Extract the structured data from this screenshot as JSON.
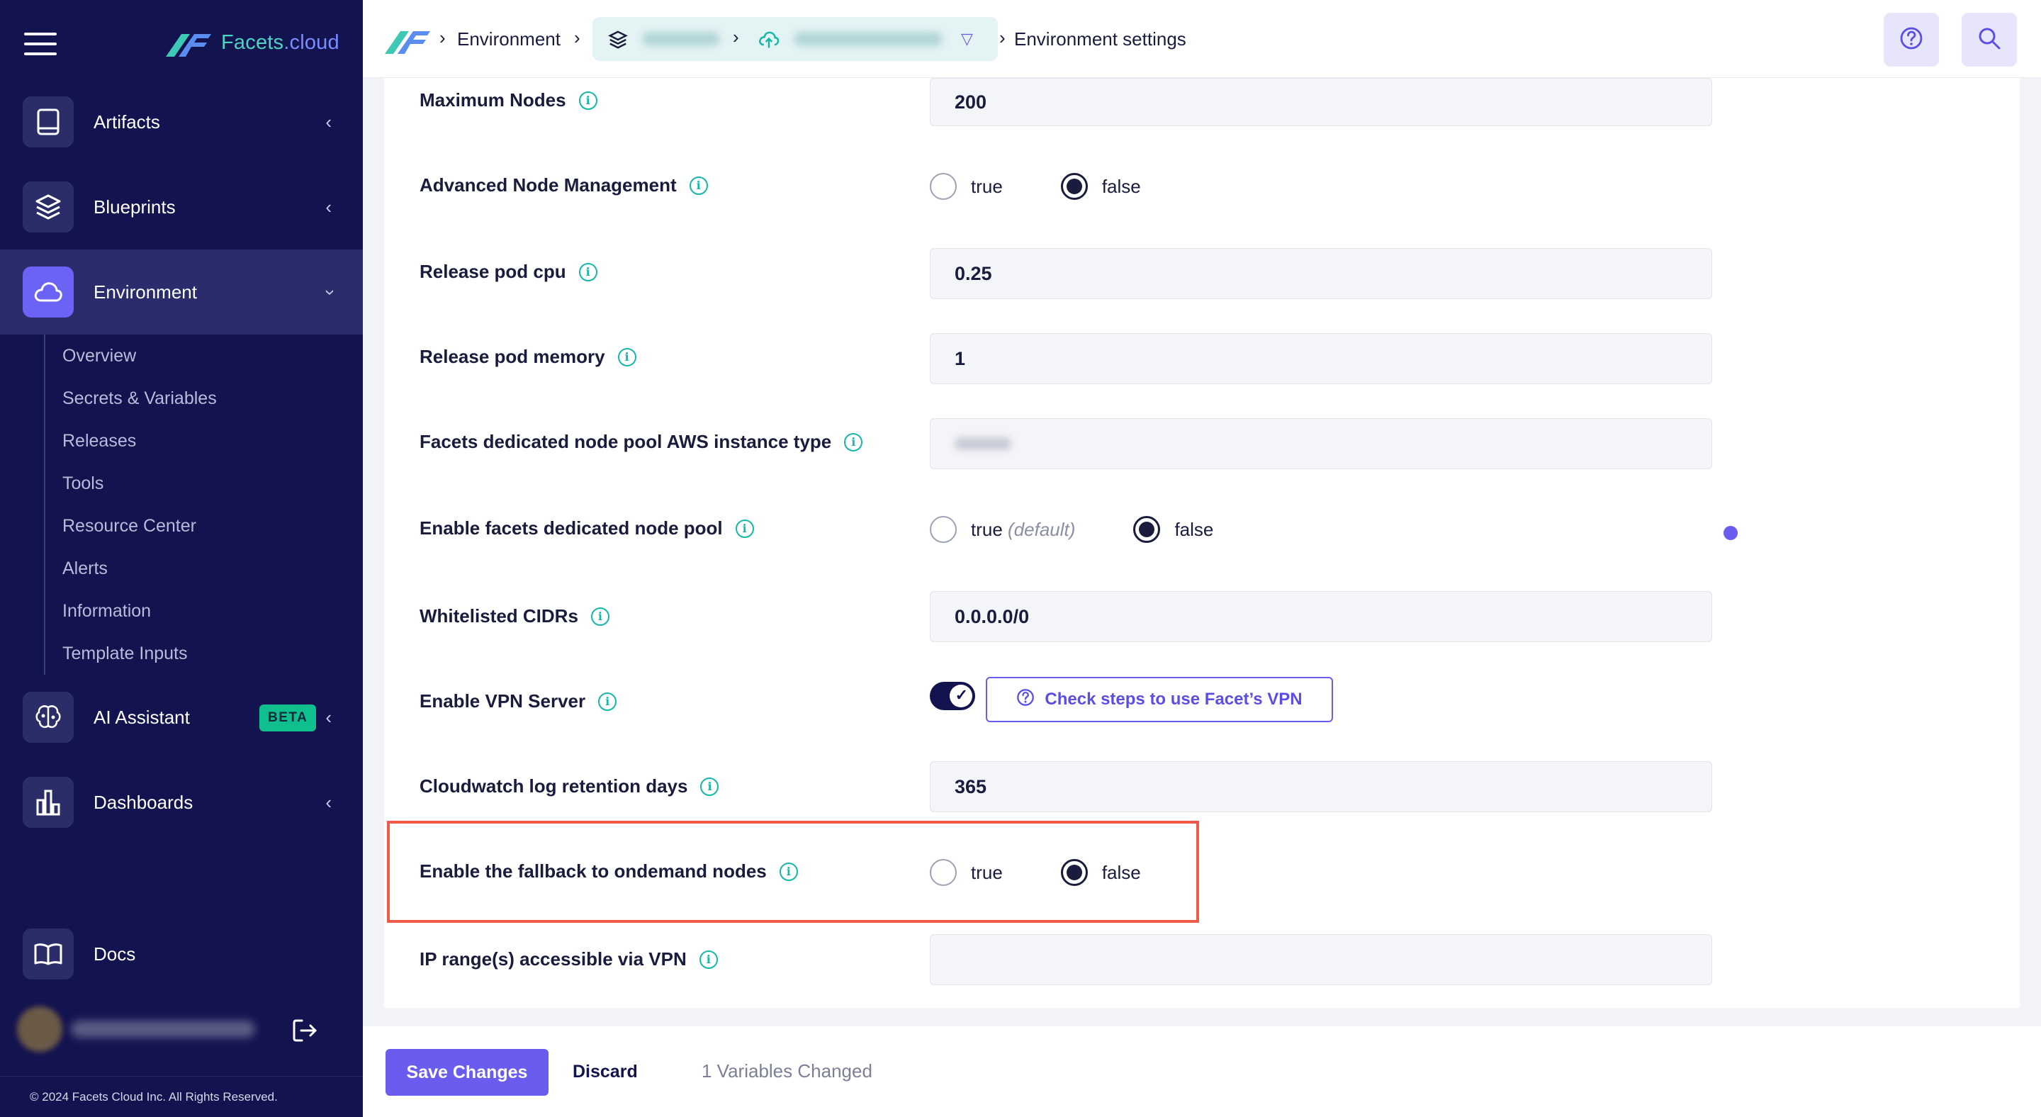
{
  "brand": {
    "name_part1": "Facets",
    "name_part2": ".cloud"
  },
  "sidebar": {
    "items": [
      {
        "label": "Artifacts",
        "icon": "artifacts-icon"
      },
      {
        "label": "Blueprints",
        "icon": "layers-icon"
      },
      {
        "label": "Environment",
        "icon": "cloud-icon",
        "active": true
      },
      {
        "label": "AI Assistant",
        "icon": "brain-icon",
        "badge": "BETA"
      },
      {
        "label": "Dashboards",
        "icon": "bar-chart-icon"
      },
      {
        "label": "Docs",
        "icon": "book-icon"
      }
    ],
    "subitems": [
      "Overview",
      "Secrets & Variables",
      "Releases",
      "Tools",
      "Resource Center",
      "Alerts",
      "Information",
      "Template Inputs"
    ],
    "copyright": "© 2024 Facets Cloud Inc. All Rights Reserved."
  },
  "breadcrumb": {
    "first": "Environment",
    "last": "Environment settings"
  },
  "settings": {
    "max_nodes": {
      "label": "Maximum Nodes",
      "value": "200"
    },
    "adv_node": {
      "label": "Advanced Node Management",
      "opt_true": "true",
      "opt_false": "false",
      "selected": "false"
    },
    "pod_cpu": {
      "label": "Release pod cpu",
      "value": "0.25"
    },
    "pod_memory": {
      "label": "Release pod memory",
      "value": "1"
    },
    "instance_type": {
      "label": "Facets dedicated node pool AWS instance type"
    },
    "dedicated_pool": {
      "label": "Enable facets dedicated node pool",
      "opt_true": "true",
      "opt_true_suffix": "(default)",
      "opt_false": "false",
      "selected": "false"
    },
    "cidrs": {
      "label": "Whitelisted CIDRs",
      "value": "0.0.0.0/0"
    },
    "vpn": {
      "label": "Enable VPN Server",
      "enabled": true,
      "button": "Check steps to use Facet’s VPN"
    },
    "cloudwatch": {
      "label": "Cloudwatch log retention days",
      "value": "365"
    },
    "fallback": {
      "label": "Enable the fallback to ondemand nodes",
      "opt_true": "true",
      "opt_false": "false",
      "selected": "false"
    },
    "ip_range": {
      "label": "IP range(s) accessible via VPN",
      "value": ""
    }
  },
  "footer": {
    "save": "Save Changes",
    "discard": "Discard",
    "changed": "1 Variables Changed"
  },
  "colors": {
    "sidebar_bg": "#13134f",
    "accent": "#6b5cf0",
    "teal": "#14b8a6",
    "highlight": "#ef5a4a"
  }
}
